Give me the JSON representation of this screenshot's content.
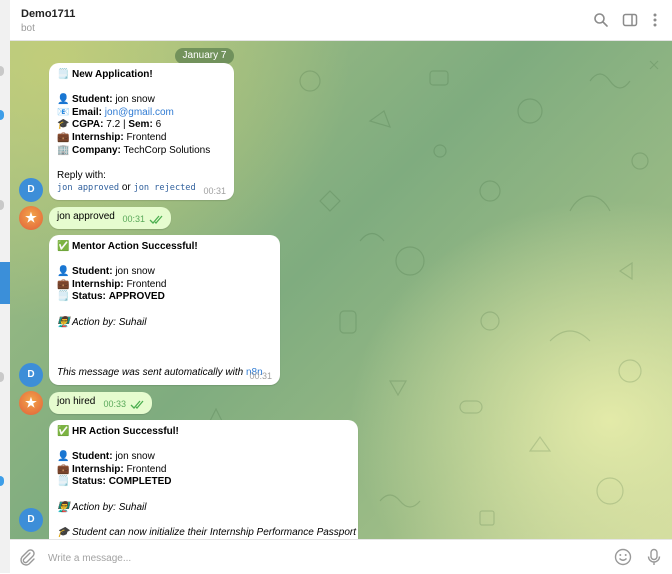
{
  "header": {
    "title": "Demo1711",
    "subtitle": "bot",
    "icons": [
      "search-icon",
      "sidebar-toggle-icon",
      "more-vertical-icon"
    ]
  },
  "chat": {
    "date_label": "January 7",
    "messages": [
      {
        "from": "bot",
        "avatar": "D",
        "time": "00:31",
        "title_emoji": "🗒️",
        "title": "New Application!",
        "fields": [
          {
            "emoji": "👤",
            "label": "Student:",
            "value": "jon snow"
          },
          {
            "emoji": "📧",
            "label": "Email:",
            "value": "jon@gmail.com"
          },
          {
            "emoji": "🎓",
            "label": "CGPA:",
            "value": "7.2 | ",
            "label2": "Sem:",
            "value2": "6"
          },
          {
            "emoji": "💼",
            "label": "Internship:",
            "value": "Frontend"
          },
          {
            "emoji": "🏢",
            "label": "Company:",
            "value": "TechCorp Solutions"
          }
        ],
        "reply_text": "Reply with:",
        "reply_cmd1": "jon approved",
        "reply_or": "or",
        "reply_cmd2": "jon rejected"
      },
      {
        "from": "user",
        "text": "jon approved",
        "time": "00:31"
      },
      {
        "from": "bot",
        "avatar": "D",
        "time": "00:31",
        "title_emoji": "✅",
        "title": "Mentor Action Successful!",
        "fields": [
          {
            "emoji": "👤",
            "label": "Student:",
            "value": "jon snow"
          },
          {
            "emoji": "💼",
            "label": "Internship:",
            "value": "Frontend"
          },
          {
            "emoji": "🗒️",
            "label": "Status:",
            "value": "APPROVED"
          }
        ],
        "action_emoji": "👨‍🏫",
        "action_text": "Action by: Suhail",
        "footer_text": "This message was sent automatically with ",
        "footer_link": "n8n"
      },
      {
        "from": "user",
        "text": "jon hired",
        "time": "00:33"
      },
      {
        "from": "bot",
        "avatar": "D",
        "title_emoji": "✅",
        "title": "HR Action Successful!",
        "fields": [
          {
            "emoji": "👤",
            "label": "Student:",
            "value": "jon snow"
          },
          {
            "emoji": "💼",
            "label": "Internship:",
            "value": "Frontend"
          },
          {
            "emoji": "🗒️",
            "label": "Status:",
            "value": "COMPLETED"
          }
        ],
        "action_emoji": "👨‍🏫",
        "action_text": "Action by: Suhail",
        "extra_emoji": "🎓",
        "extra_text": "Student can now initialize their Internship Performance Passport"
      }
    ]
  },
  "composer": {
    "placeholder": "Write a message...",
    "icons": [
      "attach-icon",
      "emoji-icon",
      "microphone-icon"
    ]
  },
  "colors": {
    "accent": "#3d8ed8",
    "outgoing_bubble": "#e6fccf",
    "chat_green": "#8db884",
    "link": "#2f7bd3"
  }
}
